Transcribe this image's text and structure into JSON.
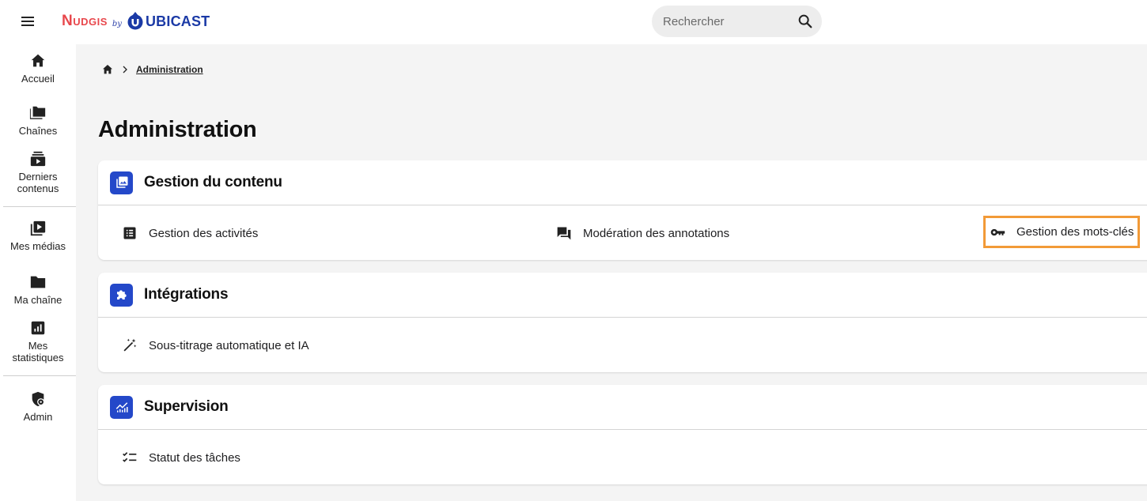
{
  "header": {
    "logo_primary": "Nudgis",
    "logo_by": "by",
    "logo_secondary": "UBICAST",
    "search_placeholder": "Rechercher"
  },
  "sidebar": {
    "items": [
      {
        "label": "Accueil",
        "icon": "home-icon"
      },
      {
        "label": "Chaînes",
        "icon": "folders-icon"
      },
      {
        "label": "Derniers contenus",
        "icon": "latest-media-icon"
      },
      {
        "label": "Mes médias",
        "icon": "play-library-icon"
      },
      {
        "label": "Ma chaîne",
        "icon": "folder-icon"
      },
      {
        "label": "Mes statistiques",
        "icon": "stats-icon"
      },
      {
        "label": "Admin",
        "icon": "shield-gear-icon"
      }
    ]
  },
  "breadcrumb": {
    "current": "Administration"
  },
  "page": {
    "title": "Administration"
  },
  "sections": [
    {
      "title": "Gestion du contenu",
      "icon": "photo-library-icon",
      "links": [
        {
          "label": "Gestion des activités",
          "icon": "list-alt-icon"
        },
        {
          "label": "Modération des annotations",
          "icon": "forum-icon"
        },
        {
          "label": "Gestion des mots-clés",
          "icon": "key-icon"
        }
      ]
    },
    {
      "title": "Intégrations",
      "icon": "extension-icon",
      "links": [
        {
          "label": "Sous-titrage automatique et IA",
          "icon": "magic-wand-icon"
        }
      ]
    },
    {
      "title": "Supervision",
      "icon": "monitoring-icon",
      "links": [
        {
          "label": "Statut des tâches",
          "icon": "checklist-icon"
        }
      ]
    }
  ],
  "colors": {
    "accent": "#2448c9",
    "highlight": "#f29a37",
    "brand_red": "#e8474c",
    "main_bg": "#f4f4f4"
  }
}
